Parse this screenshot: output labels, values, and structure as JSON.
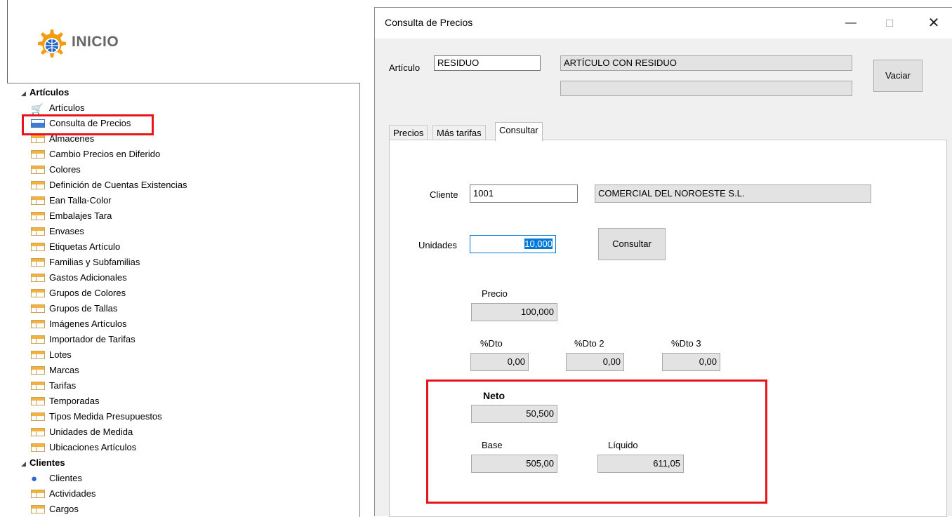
{
  "sidebar": {
    "logo_text": "INICIO",
    "groups": [
      {
        "label": "Artículos",
        "items": [
          {
            "label": "Artículos",
            "icon": "cart-icon"
          },
          {
            "label": "Consulta de Precios",
            "icon": "form-icon"
          },
          {
            "label": "Almacenes",
            "icon": "table-icon"
          },
          {
            "label": "Cambio Precios en Diferido",
            "icon": "table-icon"
          },
          {
            "label": "Colores",
            "icon": "table-icon"
          },
          {
            "label": "Definición de Cuentas Existencias",
            "icon": "table-icon"
          },
          {
            "label": "Ean Talla-Color",
            "icon": "table-icon"
          },
          {
            "label": "Embalajes Tara",
            "icon": "table-icon"
          },
          {
            "label": "Envases",
            "icon": "table-icon"
          },
          {
            "label": "Etiquetas Artículo",
            "icon": "table-icon"
          },
          {
            "label": "Familias y Subfamilias",
            "icon": "table-icon"
          },
          {
            "label": "Gastos Adicionales",
            "icon": "table-icon"
          },
          {
            "label": "Grupos de Colores",
            "icon": "table-icon"
          },
          {
            "label": "Grupos de Tallas",
            "icon": "table-icon"
          },
          {
            "label": "Imágenes Artículos",
            "icon": "table-icon"
          },
          {
            "label": "Importador de Tarifas",
            "icon": "table-icon"
          },
          {
            "label": "Lotes",
            "icon": "table-icon"
          },
          {
            "label": "Marcas",
            "icon": "table-icon"
          },
          {
            "label": "Tarifas",
            "icon": "table-icon"
          },
          {
            "label": "Temporadas",
            "icon": "table-icon"
          },
          {
            "label": "Tipos Medida Presupuestos",
            "icon": "table-icon"
          },
          {
            "label": "Unidades de Medida",
            "icon": "table-icon"
          },
          {
            "label": "Ubicaciones Artículos",
            "icon": "table-icon"
          }
        ]
      },
      {
        "label": "Clientes",
        "items": [
          {
            "label": "Clientes",
            "icon": "person-icon"
          },
          {
            "label": "Actividades",
            "icon": "table-icon"
          },
          {
            "label": "Cargos",
            "icon": "table-icon"
          }
        ]
      }
    ]
  },
  "dialog": {
    "title": "Consulta de Precios",
    "window_buttons": {
      "minimize": "—",
      "maximize": "☐",
      "close": "✕"
    },
    "articulo_label": "Artículo",
    "articulo_code": "RESIDUO",
    "articulo_desc": "ARTÍCULO CON RESIDUO",
    "articulo_desc2": "",
    "vaciar_label": "Vaciar",
    "tabs": [
      {
        "label": "Precios",
        "active": false
      },
      {
        "label": "Más tarifas",
        "active": false
      },
      {
        "label": "Consultar",
        "active": true
      }
    ],
    "cliente_label": "Cliente",
    "cliente_code": "1001",
    "cliente_name": "COMERCIAL DEL NOROESTE S.L.",
    "unidades_label": "Unidades",
    "unidades_value": "10,000",
    "consultar_button": "Consultar",
    "precio_label": "Precio",
    "precio_value": "100,000",
    "dto_label": "%Dto",
    "dto_value": "0,00",
    "dto2_label": "%Dto 2",
    "dto2_value": "0,00",
    "dto3_label": "%Dto 3",
    "dto3_value": "0,00",
    "neto_label": "Neto",
    "neto_value": "50,500",
    "base_label": "Base",
    "base_value": "505,00",
    "liquido_label": "Líquido",
    "liquido_value": "611,05"
  },
  "colors": {
    "highlight": "#e8141b",
    "selection": "#0078d7",
    "accent_icon": "#f4b23c",
    "logo": "#f39c12"
  }
}
